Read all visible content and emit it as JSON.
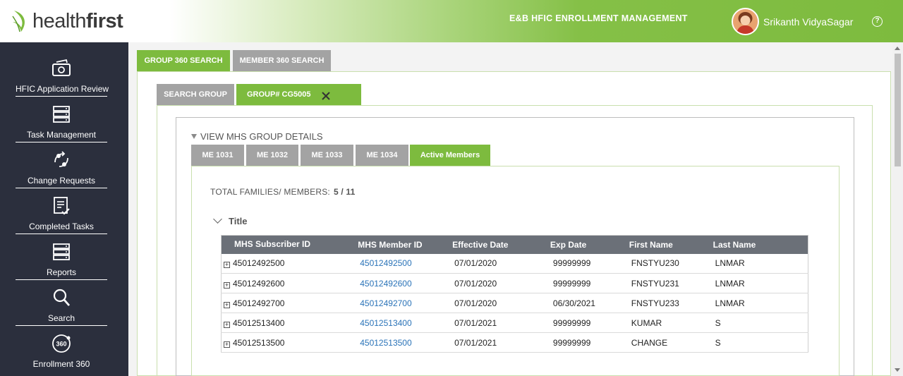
{
  "header": {
    "logo_prefix": "health",
    "logo_brand": "first",
    "app_title": "E&B HFIC ENROLLMENT MANAGEMENT",
    "user_name": "Srikanth VidyaSagar",
    "help_symbol": "?"
  },
  "sidebar": {
    "items": [
      {
        "label": "HFIC Application Review",
        "icon": "application-review-icon"
      },
      {
        "label": "Task Management",
        "icon": "server-stack-icon"
      },
      {
        "label": "Change Requests",
        "icon": "change-requests-icon"
      },
      {
        "label": "Completed Tasks",
        "icon": "clipboard-check-icon"
      },
      {
        "label": "Reports",
        "icon": "server-stack-icon"
      },
      {
        "label": "Search",
        "icon": "search-icon"
      },
      {
        "label": "Enrollment 360",
        "icon": "enrollment-360-icon"
      }
    ]
  },
  "top_tabs": [
    {
      "label": "GROUP 360 SEARCH",
      "active": true
    },
    {
      "label": "MEMBER 360 SEARCH",
      "active": false
    }
  ],
  "sub_tabs": [
    {
      "label": "SEARCH GROUP",
      "active": false
    },
    {
      "label": "GROUP# CG5005",
      "active": true
    }
  ],
  "section_title": "VIEW MHS GROUP DETAILS",
  "member_tabs": [
    {
      "label": "ME 1031",
      "active": false
    },
    {
      "label": "ME 1032",
      "active": false
    },
    {
      "label": "ME 1033",
      "active": false
    },
    {
      "label": "ME 1034",
      "active": false
    },
    {
      "label": "Active Members",
      "active": true
    }
  ],
  "totals": {
    "label": "TOTAL FAMILIES/ MEMBERS:",
    "value": "5 /  11"
  },
  "collapse_title": "Title",
  "table": {
    "columns": [
      "MHS Subscriber ID",
      "MHS Member ID",
      "Effective Date",
      "Exp Date",
      "First Name",
      "Last Name"
    ],
    "rows": [
      [
        "45012492500",
        "45012492500",
        "07/01/2020",
        "99999999",
        "FNSTYU230",
        "LNMAR"
      ],
      [
        "45012492600",
        "45012492600",
        "07/01/2020",
        "99999999",
        "FNSTYU231",
        "LNMAR"
      ],
      [
        "45012492700",
        "45012492700",
        "07/01/2020",
        "06/30/2021",
        "FNSTYU233",
        "LNMAR"
      ],
      [
        "45012513400",
        "45012513400",
        "07/01/2021",
        "99999999",
        "KUMAR",
        "S"
      ],
      [
        "45012513500",
        "45012513500",
        "07/01/2021",
        "99999999",
        "CHANGE",
        "S"
      ]
    ]
  },
  "colors": {
    "accent_green": "#7dbb3e",
    "tab_gray": "#a3a3a3",
    "sidebar_bg": "#2b2f3d",
    "table_header_bg": "#6b7078",
    "link_blue": "#2a73b8"
  }
}
